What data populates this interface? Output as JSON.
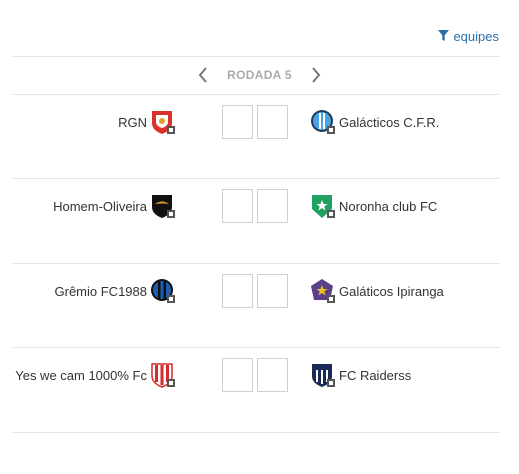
{
  "filter": {
    "label": "equipes",
    "icon": "filter-icon",
    "color": "#2c6fa8"
  },
  "round": {
    "label": "RODADA 5",
    "prev_icon": "chevron-left-icon",
    "next_icon": "chevron-right-icon"
  },
  "matches": [
    {
      "home": {
        "name": "RGN",
        "crest_icon": "red-white-shield-crest-icon",
        "colors": [
          "#d9322a",
          "#ffffff"
        ]
      },
      "away": {
        "name": "Galácticos C.F.R.",
        "crest_icon": "light-blue-striped-crest-icon",
        "colors": [
          "#4aa3df",
          "#1d3a5f"
        ]
      }
    },
    {
      "home": {
        "name": "Homem-Oliveira",
        "crest_icon": "black-eagle-crest-icon",
        "colors": [
          "#111111",
          "#e0a030"
        ]
      },
      "away": {
        "name": "Noronha club FC",
        "crest_icon": "green-star-crest-icon",
        "colors": [
          "#22a060",
          "#ffffff"
        ]
      }
    },
    {
      "home": {
        "name": "Grêmio FC1988",
        "crest_icon": "blue-black-round-crest-icon",
        "colors": [
          "#1a5fb4",
          "#111111"
        ]
      },
      "away": {
        "name": "Galáticos Ipiranga",
        "crest_icon": "purple-star-crest-icon",
        "colors": [
          "#5a3f8a",
          "#f0c020"
        ]
      }
    },
    {
      "home": {
        "name": "Yes we cam 1000% Fc",
        "crest_icon": "red-white-striped-crest-icon",
        "colors": [
          "#d62b2b",
          "#ffffff"
        ]
      },
      "away": {
        "name": "FC Raiderss",
        "crest_icon": "navy-striped-crest-icon",
        "colors": [
          "#1c2a5a",
          "#ffffff"
        ]
      }
    }
  ]
}
